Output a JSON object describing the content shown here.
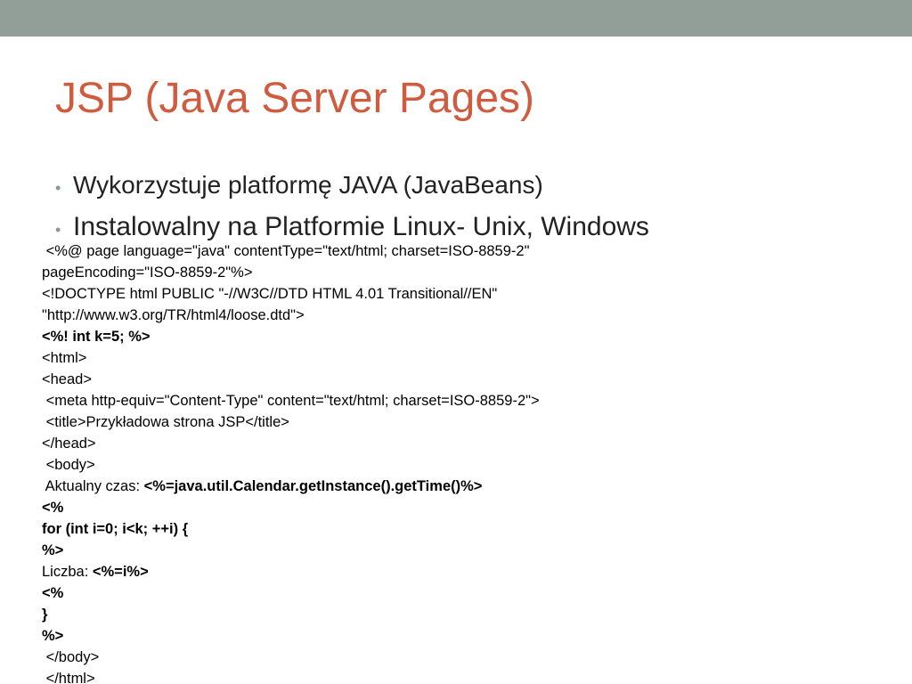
{
  "slide": {
    "title": "JSP (Java Server Pages)",
    "bullets": [
      "Wykorzystuje platformę JAVA (JavaBeans)",
      "Instalowalny na Platformie Linux- Unix, Windows"
    ],
    "code_lines": [
      {
        "normal": " <%@ page language=\"java\" contentType=\"text/html; charset=ISO-8859-2\"",
        "bold": ""
      },
      {
        "normal": "pageEncoding=\"ISO-8859-2\"%>",
        "bold": ""
      },
      {
        "normal": "<!DOCTYPE html PUBLIC \"-//W3C//DTD HTML 4.01 Transitional//EN\"",
        "bold": ""
      },
      {
        "normal": "\"http://www.w3.org/TR/html4/loose.dtd\">",
        "bold": ""
      },
      {
        "normal": "",
        "bold": "<%! int k=5; %>"
      },
      {
        "normal": "<html>",
        "bold": ""
      },
      {
        "normal": "<head>",
        "bold": ""
      },
      {
        "normal": " <meta http-equiv=\"Content-Type\" content=\"text/html; charset=ISO-8859-2\">",
        "bold": ""
      },
      {
        "normal": " <title>Przykładowa strona JSP</title>",
        "bold": ""
      },
      {
        "normal": "</head>",
        "bold": ""
      },
      {
        "normal": " <body>",
        "bold": ""
      },
      {
        "normal": " Aktualny czas: ",
        "bold": "<%=java.util.Calendar.getInstance().getTime()%>"
      },
      {
        "normal": "",
        "bold": "<%"
      },
      {
        "normal": "",
        "bold": "for (int i=0; i<k; ++i) {"
      },
      {
        "normal": "",
        "bold": "%>"
      },
      {
        "normal": "Liczba: ",
        "bold": "<%=i%>"
      },
      {
        "normal": "",
        "bold": "<%"
      },
      {
        "normal": "",
        "bold": "}"
      },
      {
        "normal": "",
        "bold": "%>"
      },
      {
        "normal": " </body>",
        "bold": ""
      },
      {
        "normal": " </html>",
        "bold": ""
      }
    ]
  },
  "colors": {
    "top_bar": "#919f98",
    "title": "#d05c3f",
    "bullet_marker": "#8a9a93"
  }
}
